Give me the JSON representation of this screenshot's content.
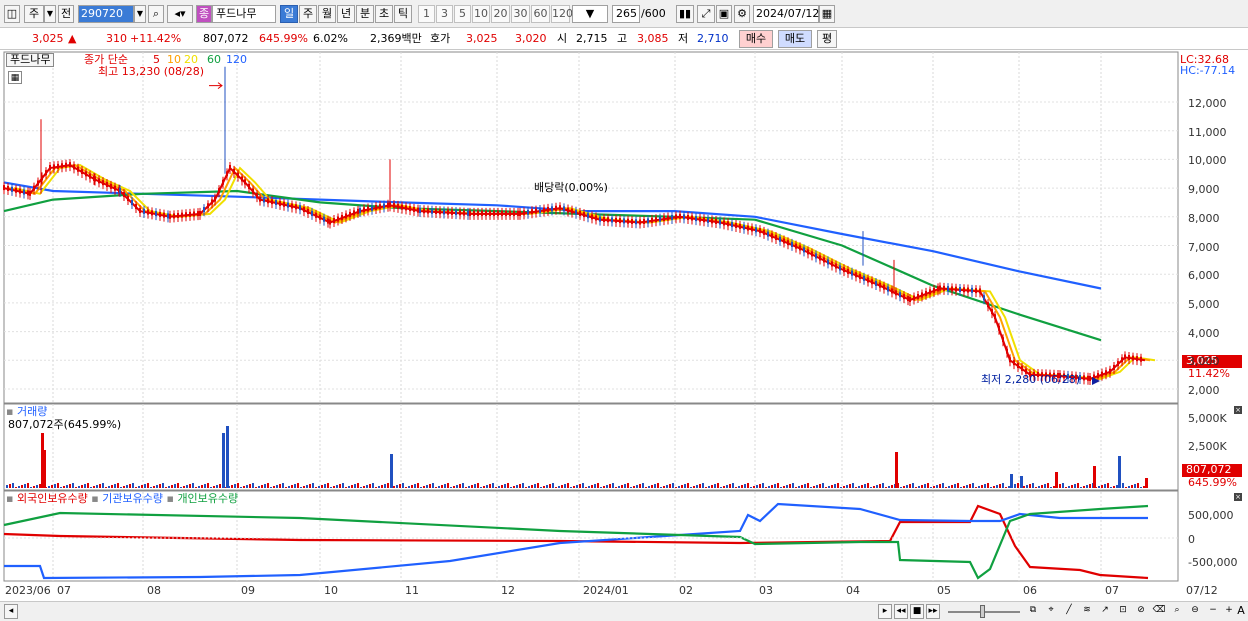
{
  "toolbar": {
    "mode": "주",
    "prev_label": "전",
    "code": "290720",
    "name_badge": "종",
    "name": "푸드나무",
    "periods": [
      "일",
      "주",
      "월",
      "년",
      "분",
      "초",
      "틱"
    ],
    "nums": [
      "1",
      "3",
      "5",
      "10",
      "20",
      "30",
      "60",
      "120"
    ],
    "count": "265",
    "total": "/600",
    "date": "2024/07/12"
  },
  "info": {
    "price": "3,025",
    "arrow": "▲",
    "change": "310",
    "pct": "+11.42%",
    "volume": "807,072",
    "vol_pct": "645.99%",
    "turnover": "6.02%",
    "amount": "2,369백만",
    "quote_label": "호가",
    "ask": "3,025",
    "bid": "3,020",
    "open_label": "시",
    "open": "2,715",
    "high_label": "고",
    "high": "3,085",
    "low_label": "저",
    "low": "2,710",
    "buy": "매수",
    "sell": "매도",
    "avg": "평"
  },
  "price_panel": {
    "name": "푸드나무",
    "ma_label": "종가 단순",
    "ma_periods": [
      "5",
      "10",
      "20",
      "60",
      "120"
    ],
    "ma_colors": [
      "#e00000",
      "#ffa000",
      "#f0e000",
      "#10a040",
      "#2060ff"
    ],
    "high_note": "최고 13,230 (08/28)",
    "div_note": "배당락(0.00%)",
    "low_note": "최저 2,280 (06/28)",
    "lc": "LC:32.68",
    "hc": "HC:-77.14",
    "last": "3,025",
    "last_pct": "11.42%",
    "y_ticks": [
      "12,000",
      "11,000",
      "10,000",
      "9,000",
      "8,000",
      "7,000",
      "6,000",
      "5,000",
      "4,000",
      "3,000",
      "2,000"
    ]
  },
  "volume_panel": {
    "title": "거래량",
    "value": "807,072주(645.99%)",
    "y_ticks": [
      "5,000K",
      "2,500K"
    ],
    "last": "807,072",
    "last_pct": "645.99%"
  },
  "holdings_panel": {
    "series": [
      "외국인보유수량",
      "기관보유수량",
      "개인보유수량"
    ],
    "colors": [
      "#e00000",
      "#2060ff",
      "#10a040"
    ],
    "y_ticks": [
      "500,000",
      "0",
      "-500,000"
    ]
  },
  "x_axis": [
    "2023/06",
    "07",
    "08",
    "09",
    "10",
    "11",
    "12",
    "2024/01",
    "02",
    "03",
    "04",
    "05",
    "06",
    "07",
    "07/12"
  ],
  "chart_data": {
    "type": "line",
    "series": [
      {
        "name": "120",
        "x": [
          "2023/06",
          "2023/07",
          "2023/08",
          "2023/09",
          "2023/10",
          "2023/11",
          "2023/12",
          "2024/01",
          "2024/02",
          "2024/03",
          "2024/04",
          "2024/05",
          "2024/06",
          "2024/07"
        ],
        "values": [
          9200,
          8900,
          8800,
          8700,
          8600,
          8500,
          8400,
          8200,
          8200,
          8000,
          7400,
          6800,
          6100,
          5500
        ]
      },
      {
        "name": "60",
        "x": [
          "2023/06",
          "2023/07",
          "2023/08",
          "2023/09",
          "2023/10",
          "2023/11",
          "2023/12",
          "2024/01",
          "2024/02",
          "2024/03",
          "2024/04",
          "2024/05",
          "2024/06",
          "2024/07"
        ],
        "values": [
          8200,
          8600,
          8800,
          8900,
          8500,
          8300,
          8200,
          8100,
          8000,
          7900,
          7000,
          5600,
          4600,
          3700
        ]
      }
    ]
  }
}
